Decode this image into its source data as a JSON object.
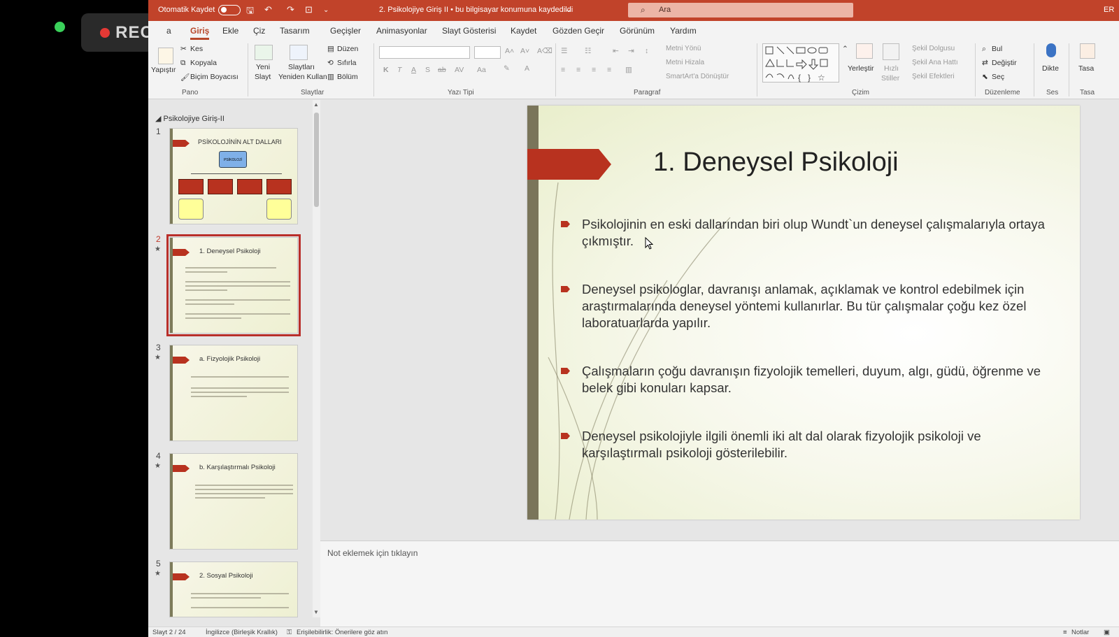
{
  "overlay": {
    "rec_label": "REC"
  },
  "titlebar": {
    "autosave_label": "Otomatik Kaydet",
    "doc_title": "2. Psikolojiye Giriş II  •  bu bilgisayar konumuna kaydedildi",
    "search_placeholder": "Ara",
    "user_initials": "ER"
  },
  "tabs": [
    "a",
    "Giriş",
    "Ekle",
    "Çiz",
    "Tasarım",
    "Geçişler",
    "Animasyonlar",
    "Slayt Gösterisi",
    "Kaydet",
    "Gözden Geçir",
    "Görünüm",
    "Yardım"
  ],
  "ribbon": {
    "pano": {
      "group": "Pano",
      "paste": "Yapıştır",
      "cut": "Kes",
      "copy": "Kopyala",
      "format_painter": "Biçim Boyacısı"
    },
    "slaytlar": {
      "group": "Slaytlar",
      "new_slide": "Yeni",
      "new_slide2": "Slayt",
      "reuse": "Slaytları",
      "reuse2": "Yeniden Kullan",
      "layout": "Düzen",
      "reset": "Sıfırla",
      "section": "Bölüm"
    },
    "yazi": {
      "group": "Yazı Tipi",
      "bold": "K",
      "italic": "T",
      "underline": "A",
      "shadow": "S",
      "strike": "ab",
      "spacing": "AV",
      "case": "Aa"
    },
    "paragraf": {
      "group": "Paragraf",
      "text_direction": "Metni Yönü",
      "align_text": "Metni Hizala",
      "smartart": "SmartArt'a Dönüştür"
    },
    "cizim": {
      "group": "Çizim",
      "arrange": "Yerleştir",
      "quick_styles": "Hızlı",
      "quick_styles2": "Stiller",
      "fill": "Şekil Dolgusu",
      "outline": "Şekil Ana Hattı",
      "effects": "Şekil Efektleri"
    },
    "duzenleme": {
      "group": "Düzenleme",
      "find": "Bul",
      "replace": "Değiştir",
      "select": "Seç"
    },
    "ses": {
      "group": "Ses",
      "dictate": "Dikte"
    },
    "tasarimci": {
      "group": "Tasa",
      "label": "Tasa"
    }
  },
  "thumbs": {
    "section_title": "Psikolojiye Giriş-II",
    "items": [
      {
        "num": "1",
        "title": "PSİKOLOJİNİN  ALT DALLARI",
        "box": "PSİKOLOJİ"
      },
      {
        "num": "2",
        "title": "1. Deneysel Psikoloji",
        "star": "★"
      },
      {
        "num": "3",
        "title": "a. Fizyolojik Psikoloji",
        "star": "★"
      },
      {
        "num": "4",
        "title": "b. Karşılaştırmalı Psikoloji",
        "star": "★"
      },
      {
        "num": "5",
        "title": "2. Sosyal Psikoloji",
        "star": "★"
      }
    ]
  },
  "slide": {
    "title": "1. Deneysel Psikoloji",
    "bullets": [
      "Psikolojinin en eski dallarından biri olup Wundt`un deneysel çalışmalarıyla ortaya çıkmıştır.",
      "Deneysel psikologlar, davranışı anlamak, açıklamak ve kontrol edebilmek için araştırmalarında deneysel yöntemi kullanırlar. Bu tür çalışmalar çoğu kez özel laboratuarlarda yapılır.",
      "Çalışmaların çoğu davranışın fizyolojik temelleri, duyum, algı, güdü, öğrenme ve belek gibi konuları kapsar.",
      "Deneysel psikolojiyle ilgili önemli iki alt dal olarak fizyolojik psikoloji ve karşılaştırmalı psikoloji gösterilebilir."
    ]
  },
  "notes": {
    "placeholder": "Not eklemek için tıklayın"
  },
  "status": {
    "slide_pos": "Slayt 2 / 24",
    "language": "İngilizce (Birleşik Krallık)",
    "accessibility": "Erişilebilirlik: Önerilere göz atın",
    "notes_btn": "Notlar"
  },
  "colors": {
    "accent": "#c1432a",
    "slide_red": "#b8321f",
    "slide_bar": "#7a755a"
  }
}
